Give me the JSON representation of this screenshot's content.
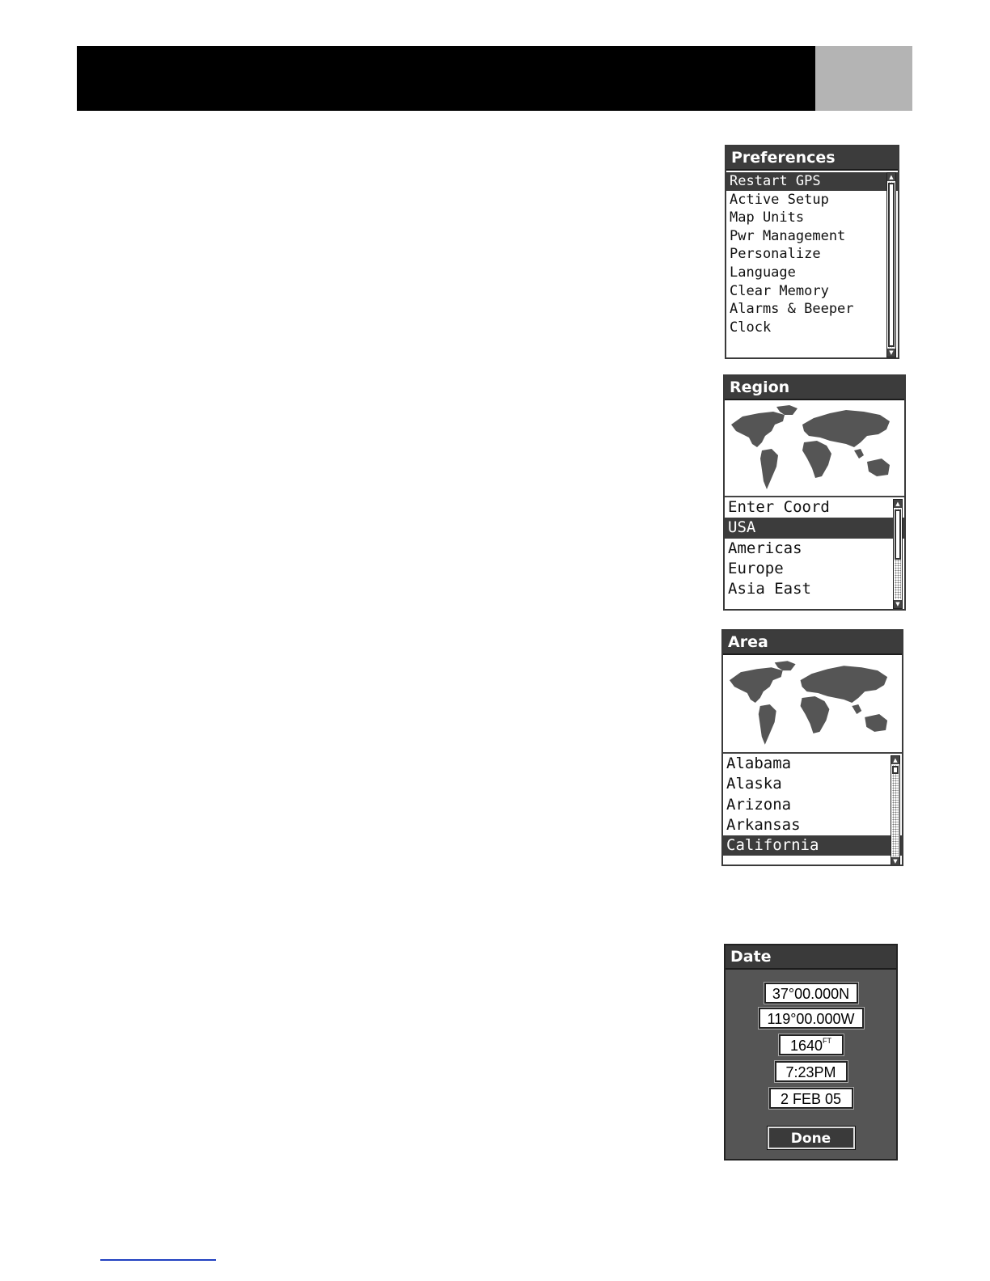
{
  "preferences": {
    "title": "Preferences",
    "items": [
      "Restart GPS",
      "Active Setup",
      "Map Units",
      "Pwr Management",
      "Personalize",
      "Language",
      "Clear Memory",
      "Alarms & Beeper",
      "Clock"
    ],
    "selected": 0
  },
  "region": {
    "title": "Region",
    "items": [
      "Enter Coord",
      "USA",
      "Americas",
      "Europe",
      "Asia East"
    ],
    "selected": 1
  },
  "area": {
    "title": "Area",
    "items": [
      "Alabama",
      "Alaska",
      "Arizona",
      "Arkansas",
      "California"
    ],
    "selected": 4
  },
  "date": {
    "title": "Date",
    "latitude": "37°00.000N",
    "longitude": "119°00.000W",
    "elevation": "1640",
    "elevation_unit": "FT",
    "time": "7:23PM",
    "date": "2 FEB 05",
    "done_label": "Done"
  },
  "colors": {
    "title_bar": "#3c3c3c",
    "highlight": "#3c3c3c",
    "date_bg": "#555555",
    "header": "#000000",
    "header_tab": "#b4b4b4"
  }
}
